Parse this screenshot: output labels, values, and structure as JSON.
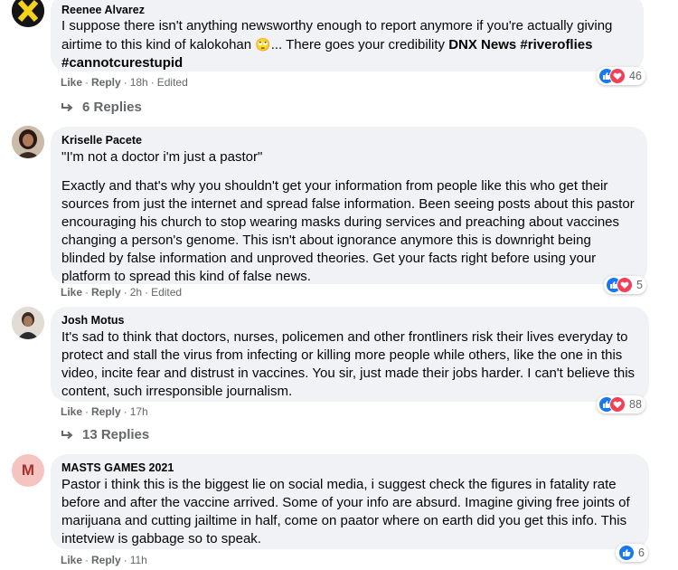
{
  "comments": [
    {
      "name": "Reenee Alvarez",
      "text_a": "I suppose there isn't anything newsworthy enough to report anymore if you're actually giving airtime to this kind of kalokohan ",
      "emoji": "🙄",
      "text_b": "... There goes your credibility ",
      "mention": "DNX News",
      "tags": "#riveroflies #cannotcurestupid",
      "like": "Like",
      "reply": "Reply",
      "time": "18h",
      "edited": "Edited",
      "reaction_count": "46",
      "replies": "6 Replies"
    },
    {
      "name": "Kriselle Pacete",
      "quote": "\"I'm not a doctor i'm just a pastor\"",
      "text": "Exactly and that's why you shouldn't get your information from people like this who get their sources from just the internet and spread false information. Been seeing posts about this pastor encouraging his church to stop wearing masks during services and preaching about vaccines changing a person's genome. This isn't about ignorance anymore this is downright being blinded by false information and unproved theories. Get your facts right before using your platform to spread this kind of false news.",
      "like": "Like",
      "reply": "Reply",
      "time": "2h",
      "edited": "Edited",
      "reaction_count": "5"
    },
    {
      "name": "Josh Motus",
      "text": "It's sad to think that doctors, nurses, policemen and other frontliners risk their lives everyday to protect and stall the virus from infecting or killing more people while others, like the one in this video, incite fear and distrust in vaccines. You sir, just made their jobs harder. I can't believe this content, such irresponsible journalism.",
      "like": "Like",
      "reply": "Reply",
      "time": "17h",
      "reaction_count": "88",
      "replies": "13 Replies"
    },
    {
      "name": "MASTS GAMES 2021",
      "avatar_letter": "M",
      "text": "Pastor i think this is the biggest lie on social media, i suggest check the figures in fatality rate before and after the vaccine arrived. Some of your info are absurd. Imagine giving free joints of marijuana and cutting jailtime in half, come on paator where on earth did you get this info. This intetview is gabbage so to speak.",
      "like": "Like",
      "reply": "Reply",
      "time": "11h",
      "reaction_count": "6"
    }
  ],
  "sep": "·",
  "colors": {
    "like": "#1877f2",
    "love": "#f33e58",
    "bubble": "#f0f2f5",
    "meta": "#65676b",
    "avatar_m": "#f5c3c0"
  }
}
